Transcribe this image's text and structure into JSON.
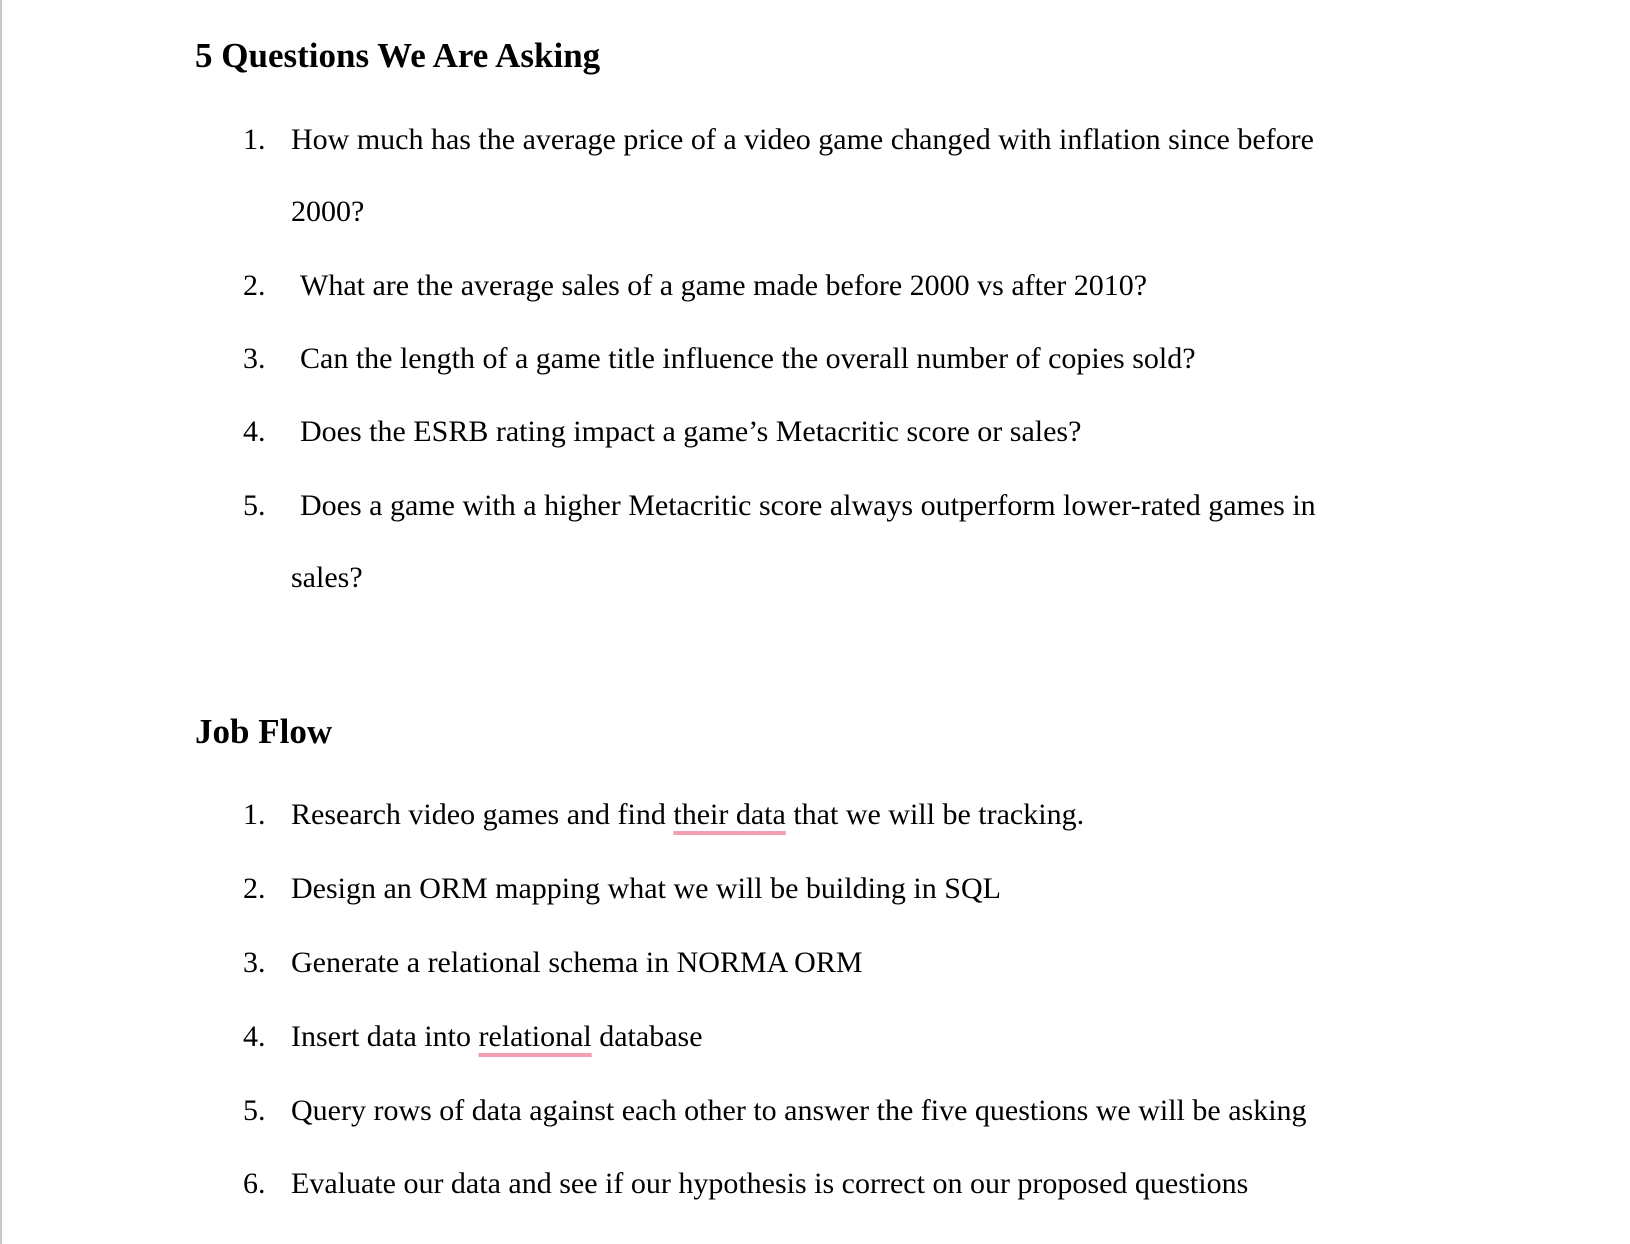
{
  "questions_section": {
    "heading": "5 Questions We Are Asking",
    "items": [
      {
        "number": "1.",
        "line1": "How much has the average price of a video game changed with inflation since before",
        "line2": "2000?"
      },
      {
        "number": "2.",
        "text": "What are the average sales of a game made before 2000 vs after 2010?"
      },
      {
        "number": "3.",
        "text": "Can the length of a game title influence the overall number of copies sold?"
      },
      {
        "number": "4.",
        "text": "Does the ESRB rating impact a game’s Metacritic score or sales?"
      },
      {
        "number": "5.",
        "line1": "Does a game with a higher Metacritic score always outperform lower-rated games in",
        "line2": "sales?"
      }
    ]
  },
  "job_flow_section": {
    "heading": "Job Flow",
    "items": [
      {
        "number": "1.",
        "text_before": "Research video games and find ",
        "flagged": "their data",
        "text_after": " that we will be tracking."
      },
      {
        "number": "2.",
        "text": "Design an ORM mapping what we will be building in SQL"
      },
      {
        "number": "3.",
        "text": "Generate a relational schema in NORMA ORM"
      },
      {
        "number": "4.",
        "text_before": "Insert data into ",
        "flagged": "relational",
        "text_after": " database"
      },
      {
        "number": "5.",
        "text": "Query rows of data against each other to answer the five questions we will be asking"
      },
      {
        "number": "6.",
        "text": "Evaluate our data and see if our hypothesis is correct on our proposed questions"
      }
    ]
  },
  "colors": {
    "spellcheck_underline": "#f4a0b4",
    "page_edge": "#c8c8c8"
  }
}
